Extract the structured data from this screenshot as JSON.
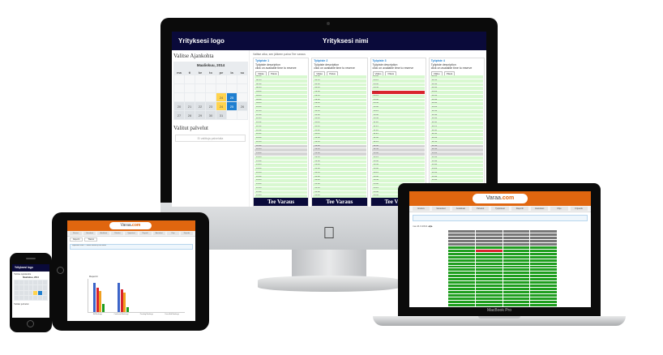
{
  "imac": {
    "logo": "Yrityksesi logo",
    "company_name": "Yrityksesi nimi",
    "calendar_title": "Valitse Ajankohta",
    "calendar_month": "Maaliskuu, 2014",
    "weekdays": [
      "ma",
      "ti",
      "ke",
      "to",
      "pe",
      "la",
      "su"
    ],
    "calendar_days": [
      "",
      "",
      "",
      "",
      "",
      "",
      "",
      "",
      "",
      "",
      "",
      "",
      "",
      "",
      "17",
      "",
      "",
      "",
      "24",
      "25",
      "",
      "20",
      "",
      "",
      "",
      "",
      "",
      "",
      "27",
      "28",
      "29",
      "30",
      "31",
      "",
      ""
    ],
    "calendar_rows_display": [
      [
        "",
        "",
        "",
        "",
        "",
        "",
        ""
      ],
      [
        "",
        "",
        "",
        "",
        "",
        "",
        ""
      ],
      [
        "",
        "",
        "",
        "",
        "24",
        "25",
        ""
      ],
      [
        "20",
        "21",
        "22",
        "23",
        "24",
        "25",
        "26"
      ],
      [
        "27",
        "28",
        "29",
        "30",
        "31",
        "",
        ""
      ]
    ],
    "today": "24",
    "selected": "25",
    "selected_title": "Valitut palvelut",
    "selected_placeholder": "Ei valittuja palveluita",
    "info_line": "Valitse aika, sen jälkeen paina Tee varaus",
    "columns": [
      {
        "name": "Työpiste 1",
        "desc": "Työpiste description",
        "note": "click on available time to reserve",
        "btn1": "Viikko",
        "btn2": "Päivä",
        "button": "Tee Varaus",
        "red_slot": -1
      },
      {
        "name": "Työpiste 2",
        "desc": "Työpiste description",
        "note": "click on available time to reserve",
        "btn1": "Viikko",
        "btn2": "Päivä",
        "button": "Tee Varaus",
        "red_slot": -1
      },
      {
        "name": "Työpiste 3",
        "desc": "Työpiste description",
        "note": "click on available time to reserve",
        "btn1": "Viikko",
        "btn2": "Päivä",
        "button": "Tee Varaus",
        "red_slot": 4
      },
      {
        "name": "Työpiste 4",
        "desc": "Työpiste description",
        "note": "click on available time to reserve",
        "btn1": "Viikko",
        "btn2": "Päivä",
        "button": "",
        "red_slot": -1
      }
    ],
    "times": [
      "08:00",
      "08:15",
      "08:30",
      "08:45",
      "09:00",
      "09:15",
      "09:30",
      "09:45",
      "10:00",
      "10:15",
      "10:30",
      "10:45",
      "11:00",
      "11:15",
      "11:30",
      "11:45",
      "12:00",
      "12:15",
      "12:30",
      "12:45",
      "13:00",
      "13:15",
      "13:30",
      "13:45",
      "14:00",
      "14:15",
      "14:30",
      "14:45",
      "15:00",
      "15:15",
      "15:30",
      "15:45"
    ],
    "grey_slots": [
      18,
      19,
      20
    ]
  },
  "macbook": {
    "brand": "Varaa.com",
    "brand_prefix": "Varaa",
    "brand_suffix": ".com",
    "label": "MacBook Pro",
    "nav": [
      "Etusivu",
      "Varaukset",
      "Asiakkaat",
      "Palvelut",
      "Työpisteet",
      "Raportit",
      "Asetukset",
      "Ohje",
      "Kirjaudu"
    ],
    "toolbar": "ma 24.3.2014 ◀ ▶",
    "rows": 24,
    "cols": 4,
    "red_cell": [
      6,
      1
    ]
  },
  "ipad": {
    "brand_prefix": "Varaa",
    "brand_suffix": ".com",
    "nav": [
      "Etusivu",
      "Varaukset",
      "Asiakkaat",
      "Palvelut",
      "Työpisteet",
      "Raportit",
      "Asetukset",
      "Ohje",
      "Kirjaudu"
    ],
    "tabs": [
      "Raportit",
      "Tilastot"
    ],
    "notice": "Raporttien selite — valitse aikaväli ja hae tiedot",
    "chart_title": "Raportti",
    "categories": [
      "All Bookings",
      "Confirmed Bookings",
      "Pending Bookings",
      "Cancelled Bookings"
    ]
  },
  "iphone": {
    "logo": "Yrityksesi logo",
    "calendar_title": "Valitse Ajankohta",
    "month": "Maaliskuu, 2014",
    "selected_title": "Valitut palvelut"
  }
}
